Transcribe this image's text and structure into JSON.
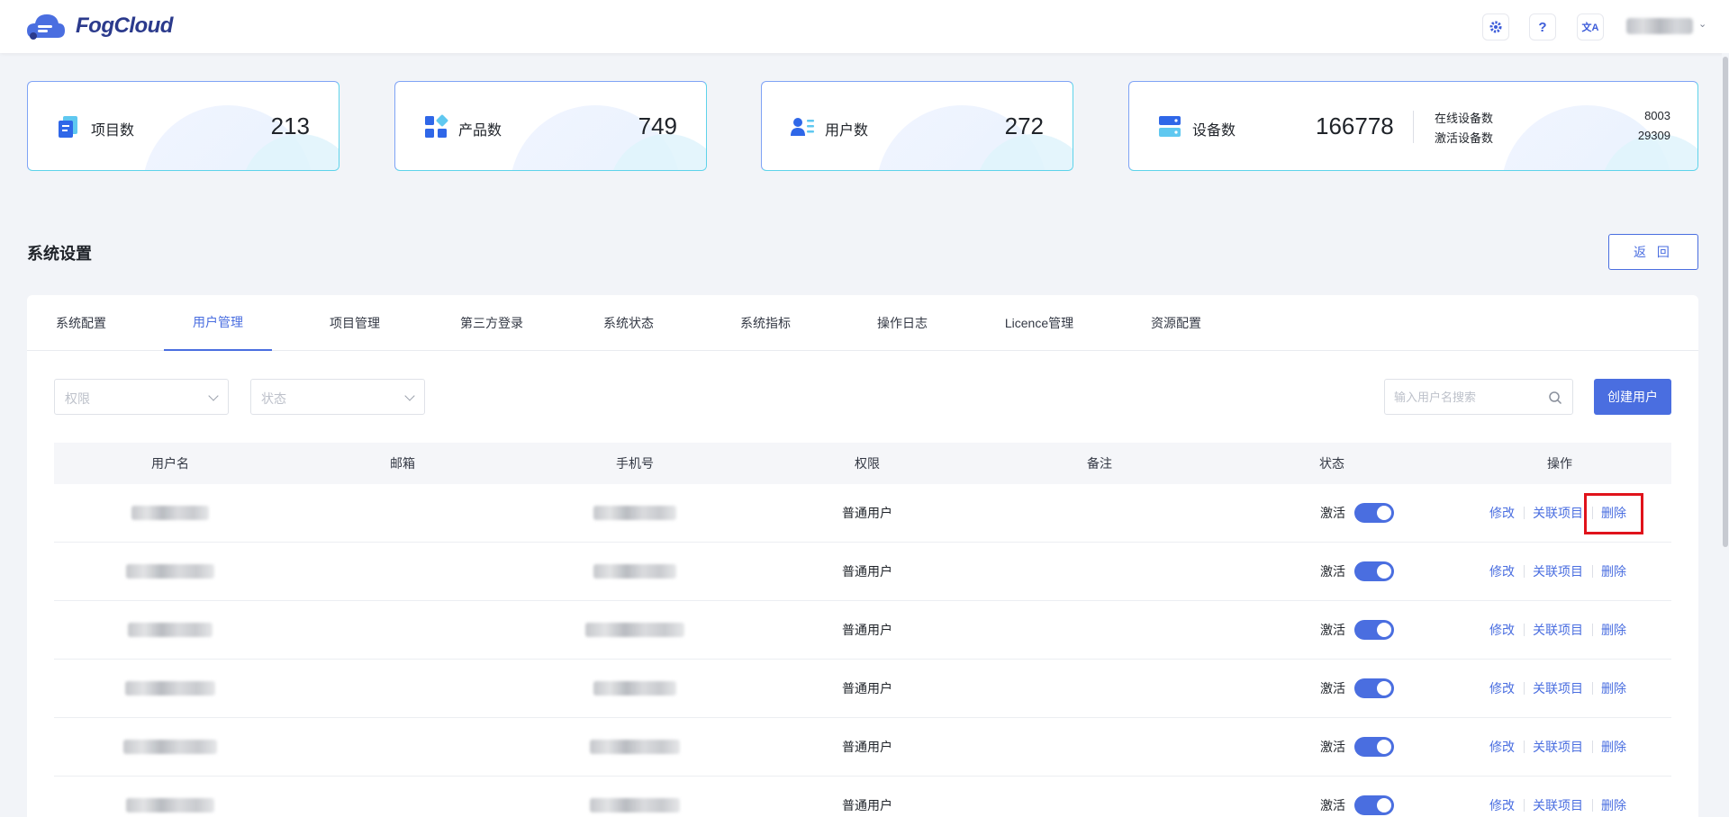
{
  "app": {
    "name": "FogCloud"
  },
  "header": {
    "icons": [
      "gear-icon",
      "help-icon",
      "translate-icon"
    ],
    "help_label": "?",
    "translate_label": "文A",
    "user_caret": "⌄"
  },
  "stats": [
    {
      "label": "项目数",
      "value": "213",
      "icon": "project-icon"
    },
    {
      "label": "产品数",
      "value": "749",
      "icon": "product-icon"
    },
    {
      "label": "用户数",
      "value": "272",
      "icon": "user-icon"
    },
    {
      "label": "设备数",
      "value": "166778",
      "icon": "device-icon",
      "online_label": "在线设备数",
      "online_value": "8003",
      "activated_label": "激活设备数",
      "activated_value": "29309"
    }
  ],
  "section": {
    "title": "系统设置",
    "back_label": "返 回"
  },
  "tabs": [
    {
      "label": "系统配置",
      "active": false
    },
    {
      "label": "用户管理",
      "active": true
    },
    {
      "label": "项目管理",
      "active": false
    },
    {
      "label": "第三方登录",
      "active": false
    },
    {
      "label": "系统状态",
      "active": false
    },
    {
      "label": "系统指标",
      "active": false
    },
    {
      "label": "操作日志",
      "active": false
    },
    {
      "label": "Licence管理",
      "active": false
    },
    {
      "label": "资源配置",
      "active": false
    }
  ],
  "filters": {
    "permission_placeholder": "权限",
    "status_placeholder": "状态",
    "search_placeholder": "输入用户名搜索",
    "create_label": "创建用户"
  },
  "table": {
    "columns": [
      "用户名",
      "邮箱",
      "手机号",
      "权限",
      "备注",
      "状态",
      "操作"
    ],
    "rows": [
      {
        "permission": "普通用户",
        "status": "激活",
        "active": true
      },
      {
        "permission": "普通用户",
        "status": "激活",
        "active": true
      },
      {
        "permission": "普通用户",
        "status": "激活",
        "active": true
      },
      {
        "permission": "普通用户",
        "status": "激活",
        "active": true
      },
      {
        "permission": "普通用户",
        "status": "激活",
        "active": true
      },
      {
        "permission": "普通用户",
        "status": "激活",
        "active": true
      }
    ],
    "actions": {
      "edit": "修改",
      "link": "关联项目",
      "delete": "删除"
    }
  },
  "colors": {
    "primary": "#4a6ee0",
    "highlight": "#e0131b",
    "background": "#f2f4f8"
  }
}
